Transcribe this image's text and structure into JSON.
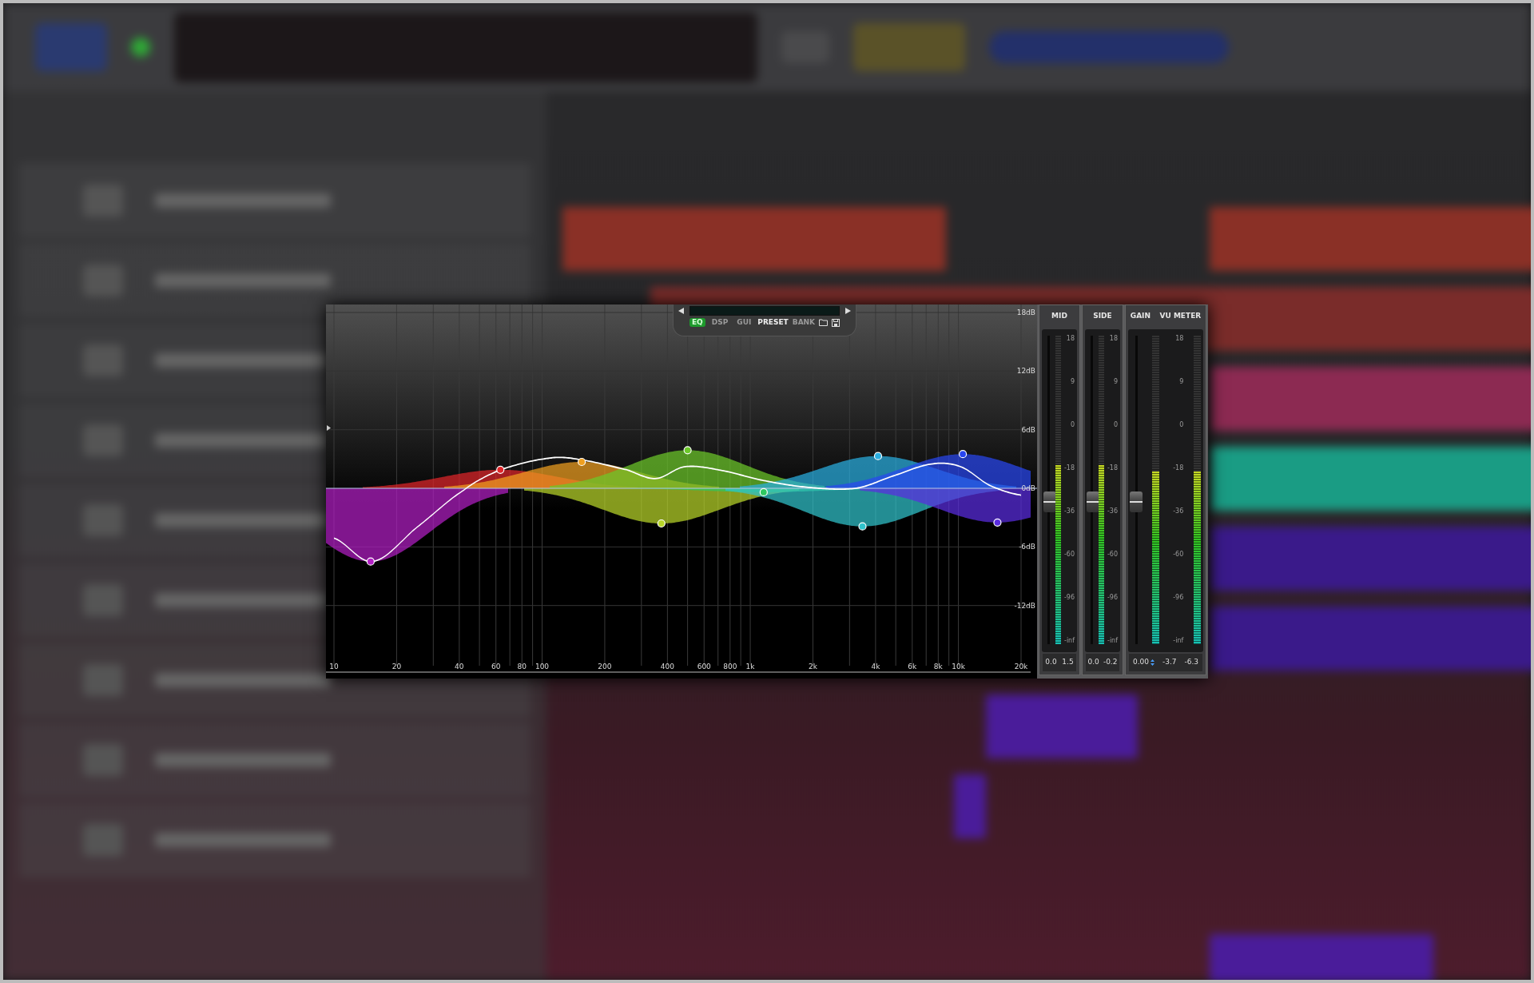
{
  "header": {
    "tabs": [
      {
        "label": "EQ",
        "selected": true
      },
      {
        "label": "DSP",
        "selected": false
      },
      {
        "label": "GUI",
        "selected": false
      }
    ],
    "modes": [
      {
        "label": "PRESET",
        "selected": true
      },
      {
        "label": "BANK",
        "selected": false
      }
    ]
  },
  "eq_graph": {
    "freq_labels": [
      "10",
      "20",
      "40",
      "60",
      "80",
      "100",
      "200",
      "400",
      "600",
      "800",
      "1k",
      "2k",
      "4k",
      "6k",
      "8k",
      "10k",
      "20k"
    ],
    "gain_labels": [
      "18dB",
      "12dB",
      "6dB",
      "0dB",
      "-6dB",
      "-12dB"
    ],
    "bands": [
      {
        "color": "#b21fc4"
      },
      {
        "color": "#e0262a"
      },
      {
        "color": "#f0a020"
      },
      {
        "color": "#b8d62a"
      },
      {
        "color": "#6cc82a"
      },
      {
        "color": "#2ec860"
      },
      {
        "color": "#30c4cc"
      },
      {
        "color": "#2aaee0"
      },
      {
        "color": "#2846f0"
      },
      {
        "color": "#5a2ce0"
      }
    ]
  },
  "strips": [
    {
      "kind": "fader_meter",
      "titles": [
        "MID"
      ],
      "fader": {
        "level": 0.46
      },
      "meters": [
        {
          "level": 0.58
        }
      ],
      "scale": [
        "18",
        "9",
        "0",
        "-18",
        "-36",
        "-60",
        "-96",
        "-inf"
      ],
      "readings": [
        "0.0",
        "1.5"
      ]
    },
    {
      "kind": "fader_meter",
      "titles": [
        "SIDE"
      ],
      "fader": {
        "level": 0.46
      },
      "meters": [
        {
          "level": 0.58
        }
      ],
      "scale": [
        "18",
        "9",
        "0",
        "-18",
        "-36",
        "-60",
        "-96",
        "-inf"
      ],
      "readings": [
        "0.0",
        "-0.2"
      ]
    },
    {
      "kind": "gain_vu",
      "titles": [
        "GAIN",
        "VU METER"
      ],
      "fader": {
        "level": 0.46
      },
      "meters": [
        {
          "level": 0.56
        },
        {
          "level": 0.56
        }
      ],
      "scale": [
        "18",
        "9",
        "0",
        "-18",
        "-36",
        "-60",
        "-96",
        "-inf"
      ],
      "readings": [
        "0.00",
        "-3.7",
        "-6.3"
      ]
    }
  ]
}
